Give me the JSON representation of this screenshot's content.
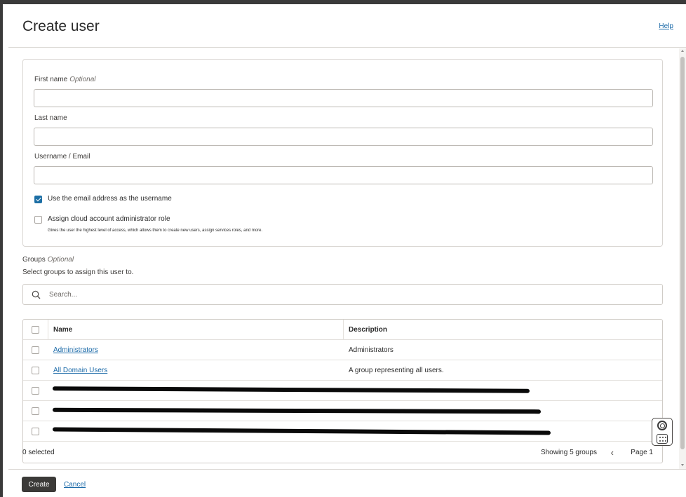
{
  "header": {
    "title": "Create user",
    "help_label": "Help"
  },
  "form": {
    "first_name": {
      "label": "First name",
      "optional": "Optional",
      "value": ""
    },
    "last_name": {
      "label": "Last name",
      "value": ""
    },
    "username": {
      "label": "Username / Email",
      "value": ""
    },
    "use_email_checkbox": {
      "label": "Use the email address as the username",
      "checked": true
    },
    "admin_role_checkbox": {
      "label": "Assign cloud account administrator role",
      "checked": false,
      "description": "Gives the user the highest level of access, which allows them to create new users, assign services roles, and more."
    }
  },
  "groups": {
    "label": "Groups",
    "optional": "Optional",
    "hint": "Select groups to assign this user to.",
    "search_placeholder": "Search...",
    "columns": {
      "name": "Name",
      "description": "Description"
    },
    "rows": [
      {
        "name": "Administrators",
        "description": "Administrators",
        "redacted": false
      },
      {
        "name": "All Domain Users",
        "description": "A group representing all users.",
        "redacted": false
      },
      {
        "name": "",
        "description": "",
        "redacted": true
      },
      {
        "name": "",
        "description": "",
        "redacted": true
      },
      {
        "name": "",
        "description": "",
        "redacted": true
      }
    ],
    "selected_count": "0 selected",
    "showing": "Showing 5 groups",
    "page": "Page 1"
  },
  "footer": {
    "create_label": "Create",
    "cancel_label": "Cancel"
  },
  "colors": {
    "accent": "#1d6fa5",
    "link": "#1b6aa8",
    "primary_button": "#3b3a38"
  },
  "icons": {
    "search": "search-icon",
    "prev": "chevron-left-icon",
    "help_widget": "lifebuoy-icon"
  }
}
